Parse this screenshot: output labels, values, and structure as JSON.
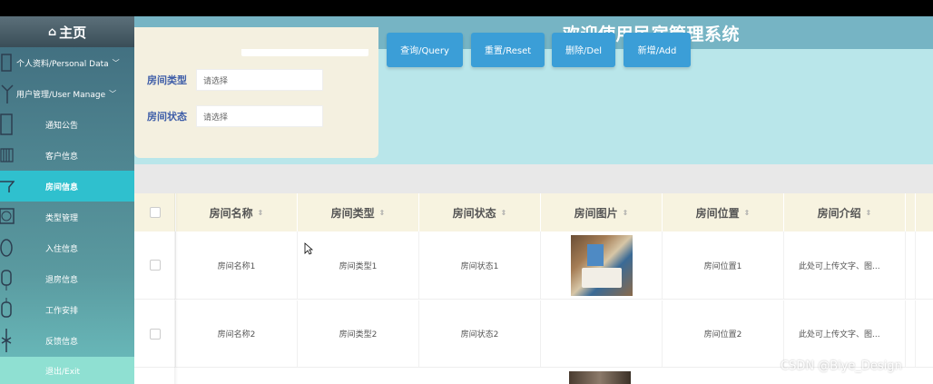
{
  "header": {
    "title": "欢迎使用民宿管理系统"
  },
  "sidebar": {
    "home": "主页",
    "items": [
      {
        "label": "个人资料/Personal Data",
        "type": "top"
      },
      {
        "label": "用户管理/User Manage",
        "type": "top"
      },
      {
        "label": "通知公告",
        "type": "sub"
      },
      {
        "label": "客户信息",
        "type": "sub"
      },
      {
        "label": "房间信息",
        "type": "sub",
        "active": true
      },
      {
        "label": "类型管理",
        "type": "sub"
      },
      {
        "label": "入住信息",
        "type": "sub"
      },
      {
        "label": "退房信息",
        "type": "sub"
      },
      {
        "label": "工作安排",
        "type": "sub"
      },
      {
        "label": "反馈信息",
        "type": "sub"
      }
    ],
    "exit": "退出/Exit"
  },
  "search": {
    "fields": [
      {
        "label": "房间类型",
        "placeholder": "请选择"
      },
      {
        "label": "房间状态",
        "placeholder": "请选择"
      }
    ]
  },
  "buttons": {
    "query": "查询/Query",
    "reset": "重置/Reset",
    "delete": "删除/Del",
    "add": "新增/Add"
  },
  "table": {
    "headers": [
      "房间名称",
      "房间类型",
      "房间状态",
      "房间图片",
      "房间位置",
      "房间介绍"
    ],
    "rows": [
      {
        "name": "房间名称1",
        "type": "房间类型1",
        "status": "房间状态1",
        "location": "房间位置1",
        "intro": "此处可上传文字、图..."
      },
      {
        "name": "房间名称2",
        "type": "房间类型2",
        "status": "房间状态2",
        "location": "房间位置2",
        "intro": "此处可上传文字、图..."
      }
    ]
  },
  "watermark": "CSDN @Biye_Design",
  "colors": {
    "accent": "#2fc0ce",
    "button": "#3b9ed7",
    "header": "#76b4c4",
    "label": "#3f5ea8"
  }
}
